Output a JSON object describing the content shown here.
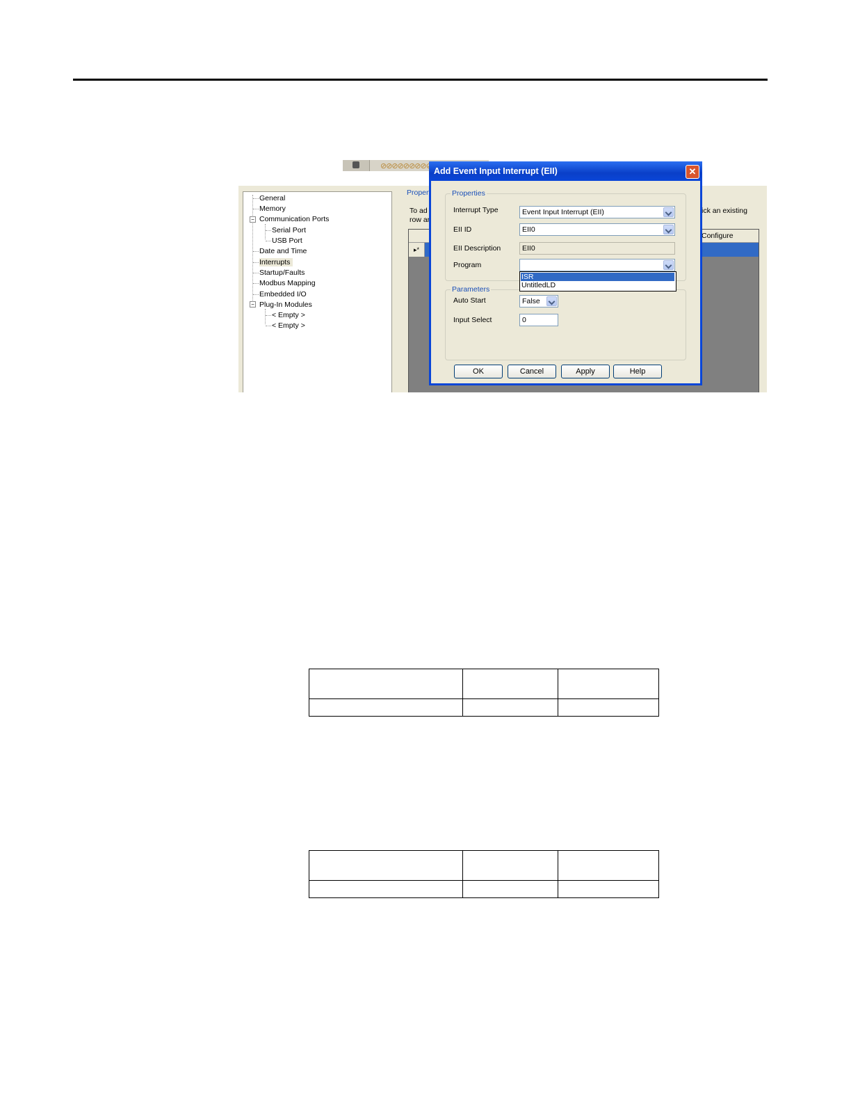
{
  "tree": {
    "items": [
      {
        "label": "General"
      },
      {
        "label": "Memory"
      },
      {
        "label": "Communication Ports"
      },
      {
        "label": "Serial Port"
      },
      {
        "label": "USB Port"
      },
      {
        "label": "Date and Time"
      },
      {
        "label": "Interrupts"
      },
      {
        "label": "Startup/Faults"
      },
      {
        "label": "Modbus Mapping"
      },
      {
        "label": "Embedded I/O"
      },
      {
        "label": "Plug-In Modules"
      },
      {
        "label": "< Empty >"
      },
      {
        "label": "< Empty >"
      }
    ],
    "expander_symbol": "−"
  },
  "right_panel": {
    "group_label": "Propert",
    "description_line1": "To ad",
    "description_line2": "row ar",
    "description_tail": "ick an existing",
    "grid_column": "Configure",
    "row_marker": "▸*"
  },
  "dialog": {
    "title": "Add Event Input Interrupt (EII)",
    "close_symbol": "✕",
    "properties_legend": "Properties",
    "interrupt_type_label": "Interrupt Type",
    "interrupt_type_value": "Event Input Interrupt (EII)",
    "eii_id_label": "EII ID",
    "eii_id_value": "EII0",
    "eii_description_label": "EII Description",
    "eii_description_value": "EII0",
    "program_label": "Program",
    "program_value": "",
    "program_options": [
      "ISR",
      "UntitledLD"
    ],
    "parameters_legend": "Parameters",
    "auto_start_label": "Auto Start",
    "auto_start_value": "False",
    "input_select_label": "Input Select",
    "input_select_value": "0",
    "buttons": {
      "ok": "OK",
      "cancel": "Cancel",
      "apply": "Apply",
      "help": "Help"
    }
  },
  "toolbar": {
    "decor": "⊘⊘⊘⊘⊘⊘⊘⊘⊘⊘⊘⊘⊘⊘"
  }
}
